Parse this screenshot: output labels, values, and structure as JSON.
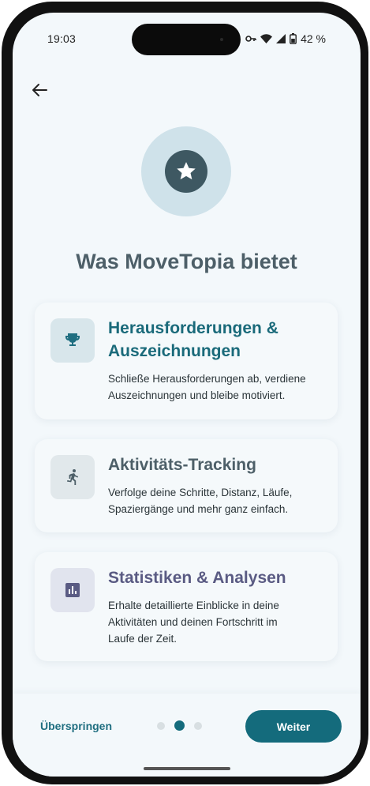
{
  "status": {
    "time": "19:03",
    "battery": "42 %",
    "icons": [
      "key-icon",
      "wifi-icon",
      "signal-icon",
      "battery-icon"
    ]
  },
  "header": {
    "back_icon": "arrow-left-icon"
  },
  "hero": {
    "icon": "star-circle-icon",
    "title": "Was MoveTopia bietet"
  },
  "features": [
    {
      "title_line1": "Herausforderungen &",
      "title_line2": "Auszeichnungen",
      "desc_line1": "Schließe Herausforderungen ab, verdiene",
      "desc_line2": "Auszeichnungen und bleibe motiviert.",
      "icon": "trophy-icon",
      "title_color": "#1a6a7a",
      "icon_bg": "#d8e6eb",
      "icon_color": "#1f6e80"
    },
    {
      "title": "Aktivitäts-Tracking",
      "desc_line1": "Verfolge deine Schritte, Distanz, Läufe,",
      "desc_line2": "Spaziergänge und mehr ganz einfach.",
      "icon": "running-person-icon",
      "title_color": "#4d5f68",
      "icon_bg": "#e1e8eb",
      "icon_color": "#4d5f68"
    },
    {
      "title": "Statistiken & Analysen",
      "desc_line1": "Erhalte detaillierte Einblicke in deine",
      "desc_line2": "Aktivitäten und deinen Fortschritt im",
      "desc_line3": "Laufe der Zeit.",
      "icon": "bar-chart-icon",
      "title_color": "#5a5b83",
      "icon_bg": "#e1e4ee",
      "icon_color": "#5a5b83"
    }
  ],
  "footer": {
    "skip_label": "Überspringen",
    "next_label": "Weiter",
    "page_count": 3,
    "active_page": 2
  }
}
